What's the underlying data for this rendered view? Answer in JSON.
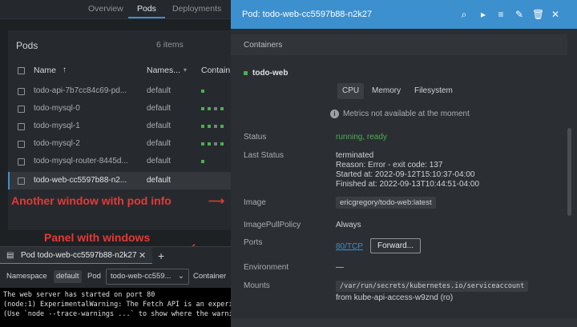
{
  "top_tabs": [
    "Overview",
    "Pods",
    "Deployments"
  ],
  "pods": {
    "title": "Pods",
    "count": "6 items",
    "columns": {
      "name": "Name",
      "namespace": "Names...",
      "containers": "Contain..."
    },
    "rows": [
      {
        "name": "todo-api-7b7cc84c69-pd...",
        "namespace": "default"
      },
      {
        "name": "todo-mysql-0",
        "namespace": "default"
      },
      {
        "name": "todo-mysql-1",
        "namespace": "default"
      },
      {
        "name": "todo-mysql-2",
        "namespace": "default"
      },
      {
        "name": "todo-mysql-router-8445d...",
        "namespace": "default"
      },
      {
        "name": "todo-web-cc5597b88-n2...",
        "namespace": "default"
      }
    ]
  },
  "annotations": {
    "window": "Another window with pod info",
    "panel": "Panel with windows"
  },
  "dock": {
    "tab_label": "Pod todo-web-cc5597b88-n2k27",
    "namespace_label": "Namespace",
    "namespace_value": "default",
    "pod_label": "Pod",
    "pod_value": "todo-web-cc559...",
    "container_label": "Container",
    "terminal_lines": [
      "The web server has started on port 80",
      "(node:1) ExperimentalWarning: The Fetch API is an experime",
      "(Use `node --trace-warnings ...` to show where the warning"
    ]
  },
  "drawer": {
    "title": "Pod: todo-web-cc5597b88-n2k27",
    "section": "Containers",
    "container_name": "todo-web",
    "tabs": [
      "CPU",
      "Memory",
      "Filesystem"
    ],
    "metrics_note": "Metrics not available at the moment",
    "status_label": "Status",
    "status_value": "running, ready",
    "last_status_label": "Last Status",
    "last_status_lines": [
      "terminated",
      "Reason: Error - exit code: 137",
      "Started at: 2022-09-12T15:10:37-04:00",
      "Finished at: 2022-09-13T10:44:51-04:00"
    ],
    "image_label": "Image",
    "image_value": "ericgregory/todo-web:latest",
    "pull_policy_label": "ImagePullPolicy",
    "pull_policy_value": "Always",
    "ports_label": "Ports",
    "ports_value": "80/TCP",
    "forward_label": "Forward...",
    "env_label": "Environment",
    "env_value": "—",
    "mounts_label": "Mounts",
    "mounts_path": "/var/run/secrets/kubernetes.io/serviceaccount",
    "mounts_from": "from kube-api-access-w9znd (ro)"
  },
  "colors": {
    "accent": "#3d90ce",
    "ok": "#4caf50",
    "annotation": "#e53935"
  }
}
